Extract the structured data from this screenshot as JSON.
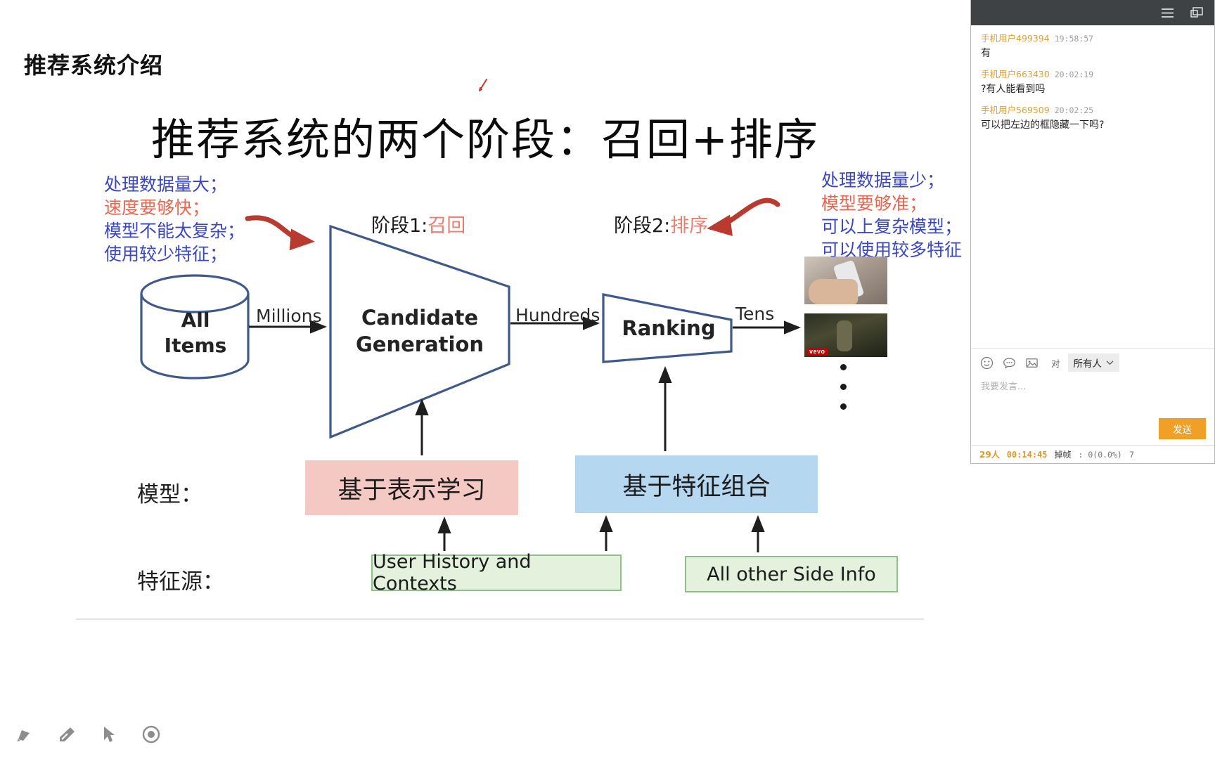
{
  "slide": {
    "header": "推荐系统介绍",
    "title": "推荐系统的两个阶段：召回+排序",
    "annotations": {
      "left": [
        {
          "text": "处理数据量大；",
          "color": "#3b46c4"
        },
        {
          "text": "速度要够快；",
          "color": "#e8654e"
        },
        {
          "text": "模型不能太复杂；",
          "color": "#3b46c4"
        },
        {
          "text": "使用较少特征；",
          "color": "#3b46c4"
        }
      ],
      "right": [
        {
          "text": "处理数据量少；",
          "color": "#3b46c4"
        },
        {
          "text": "模型要够准；",
          "color": "#e8654e"
        },
        {
          "text": "可以上复杂模型；",
          "color": "#3b46c4"
        },
        {
          "text": "可以使用较多特征",
          "color": "#3b46c4"
        }
      ]
    },
    "stage1": {
      "prefix": "阶段1:",
      "name": "召回"
    },
    "stage2": {
      "prefix": "阶段2:",
      "name": "排序"
    },
    "nodes": {
      "source_line1": "All",
      "source_line2": "Items",
      "candidate_line1": "Candidate",
      "candidate_line2": "Generation",
      "ranking": "Ranking"
    },
    "flow_labels": {
      "millions": "Millions",
      "hundreds": "Hundreds",
      "tens": "Tens"
    },
    "row_labels": {
      "model": "模型：",
      "feature_source": "特征源："
    },
    "model_boxes": {
      "left": "基于表示学习",
      "right": "基于特征组合"
    },
    "feature_boxes": {
      "left": "User History and Contexts",
      "right": "All other Side Info"
    },
    "thumbnail_badge": "vevo",
    "colors": {
      "model_left_bg": "#f4c9c4",
      "model_right_bg": "#b5d7ef",
      "feature_bg": "#e3f1dd",
      "feature_border": "#8fc08a",
      "diagram_stroke": "#3f5a8a",
      "annotation_arrow": "#b93a2e",
      "accent_blue": "#3b46c4",
      "accent_red": "#e8654e"
    }
  },
  "toolbar": {
    "tools": [
      {
        "name": "pen-tool",
        "label": "画笔"
      },
      {
        "name": "eraser-tool",
        "label": "橡皮擦"
      },
      {
        "name": "pointer-tool",
        "label": "选择"
      },
      {
        "name": "laser-tool",
        "label": "激光笔"
      }
    ]
  },
  "chat": {
    "header": {
      "menu_icon": "hamburger-menu-icon",
      "window_icon": "window-restore-icon"
    },
    "messages": [
      {
        "user": "手机用户499394",
        "time": "19:58:57",
        "body": "有"
      },
      {
        "user": "手机用户663430",
        "time": "20:02:19",
        "body": "?有人能看到吗"
      },
      {
        "user": "手机用户569509",
        "time": "20:02:25",
        "body": "可以把左边的框隐藏一下吗?"
      }
    ],
    "compose": {
      "emoji_icon": "smiley-face-icon",
      "quick_reply_icon": "speech-bubble-icon",
      "image_icon": "image-icon",
      "to_label": "对",
      "to_value": "所有人",
      "placeholder": "我要发言...",
      "send_label": "发送"
    },
    "status": {
      "viewer_count": "29人",
      "elapsed": "00:14:45",
      "drop_label": "掉帧",
      "drop_value": ": 0(0.0%)",
      "tail": "7"
    }
  }
}
